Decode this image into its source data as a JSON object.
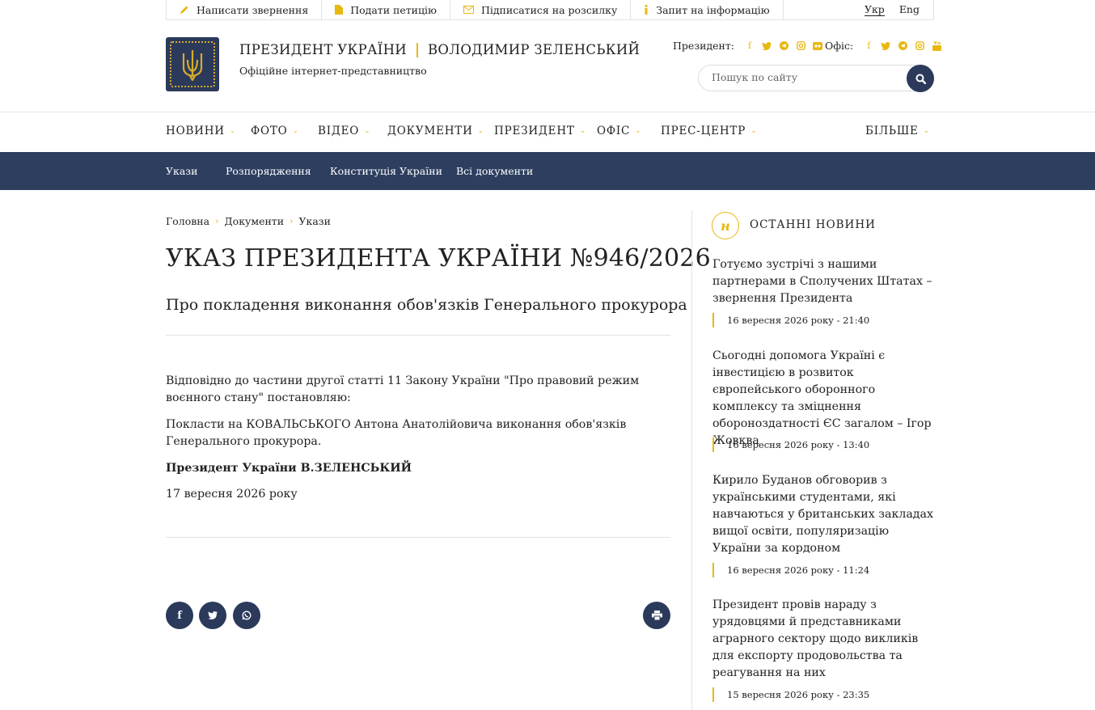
{
  "topbar": {
    "links": [
      {
        "label": "Написати звернення",
        "icon": "pencil-icon"
      },
      {
        "label": "Подати петицію",
        "icon": "document-icon"
      },
      {
        "label": "Підписатися на розсилку",
        "icon": "envelope-icon"
      },
      {
        "label": "Запит на інформацію",
        "icon": "info-icon"
      }
    ],
    "languages": [
      "Укр",
      "Eng"
    ]
  },
  "header": {
    "title_left": "ПРЕЗИДЕНТ УКРАЇНИ",
    "title_right": "ВОЛОДИМИР ЗЕЛЕНСЬКИЙ",
    "subtitle": "Офіційне інтернет-представництво",
    "socials_president_label": "Президент:",
    "socials_office_label": "Офіс:",
    "socials_president": [
      "facebook-icon",
      "twitter-icon",
      "telegram-icon",
      "instagram-icon",
      "flickr-icon"
    ],
    "socials_office": [
      "facebook-icon",
      "twitter-icon",
      "telegram-icon",
      "instagram-icon",
      "youtube-icon"
    ],
    "search_placeholder": "Пошук по сайту"
  },
  "mainnav": {
    "items": [
      "НОВИНИ",
      "ФОТО",
      "ВІДЕО",
      "ДОКУМЕНТИ",
      "ПРЕЗИДЕНТ",
      "ОФІС",
      "ПРЕС-ЦЕНТР"
    ],
    "more": "БІЛЬШЕ"
  },
  "subnav": {
    "items": [
      "Укази",
      "Розпорядження",
      "Конституція України",
      "Всі документи"
    ]
  },
  "breadcrumb": [
    "Головна",
    "Документи",
    "Укази"
  ],
  "article": {
    "title": "УКАЗ ПРЕЗИДЕНТА УКРАЇНИ №946/2026",
    "subtitle": "Про покладення виконання обов'язків Генерального прокурора",
    "paragraphs": [
      "Відповідно до частини другої статті 11 Закону України \"Про правовий режим воєнного стану\" постановляю:",
      "Покласти на КОВАЛЬСЬКОГО Антона Анатолійовича виконання обов'язків Генерального прокурора."
    ],
    "signature": "Президент України В.ЗЕЛЕНСЬКИЙ",
    "date": "17 вересня 2026 року"
  },
  "share": [
    "facebook-icon",
    "twitter-icon",
    "whatsapp-icon"
  ],
  "print_icon": "print-icon",
  "sidebar": {
    "badge": "н",
    "heading": "ОСТАННІ НОВИНИ",
    "news": [
      {
        "title": "Готуємо зустрічі з нашими партнерами в Сполучених Штатах – звернення Президента",
        "date": "16 вересня 2026 року - 21:40"
      },
      {
        "title": "Сьогодні допомога Україні є інвестицією в розвиток європейського оборонного комплексу та зміцнення обороноздатності ЄС загалом – Ігор Жовква",
        "date": "16 вересня 2026 року - 13:40"
      },
      {
        "title": "Кирило Буданов обговорив з українськими студентами, які навчаються у британських закладах вищої освіти, популяризацію України за кордоном",
        "date": "16 вересня 2026 року - 11:24"
      },
      {
        "title": "Президент провів нараду з урядовцями й представниками аграрного сектору щодо викликів для експорту продовольства та реагування на них",
        "date": "15 вересня 2026 року - 23:35"
      }
    ]
  },
  "colors": {
    "accent": "#e8b810",
    "navy": "#2d3e5f"
  }
}
